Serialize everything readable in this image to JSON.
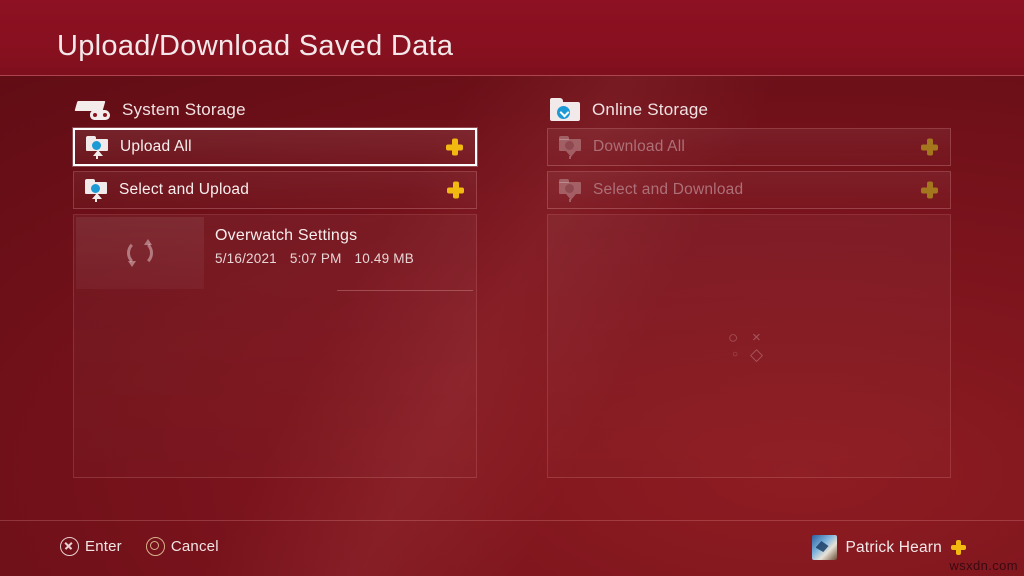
{
  "header": {
    "title": "Upload/Download Saved Data"
  },
  "panels": {
    "left": {
      "heading": "System Storage",
      "heading_icon": "console-icon",
      "actions": [
        {
          "label": "Upload All",
          "icon": "upload-folder-icon",
          "badge": "ps-plus-icon",
          "selected": true,
          "disabled": false
        },
        {
          "label": "Select and Upload",
          "icon": "upload-folder-icon",
          "badge": "ps-plus-icon",
          "selected": false,
          "disabled": false
        }
      ],
      "items": [
        {
          "title": "Overwatch Settings",
          "date": "5/16/2021",
          "time": "5:07 PM",
          "size": "10.49 MB",
          "thumb_icon": "sync-icon"
        }
      ]
    },
    "right": {
      "heading": "Online Storage",
      "heading_icon": "folder-download-icon",
      "actions": [
        {
          "label": "Download All",
          "icon": "download-folder-icon",
          "badge": "ps-plus-icon",
          "selected": false,
          "disabled": true
        },
        {
          "label": "Select and Download",
          "icon": "download-folder-icon",
          "badge": "ps-plus-icon",
          "selected": false,
          "disabled": true
        }
      ],
      "empty_watermark": {
        "circle": "○",
        "cross": "×",
        "dot": "○",
        "diamond": "◇"
      }
    }
  },
  "footer": {
    "hints": [
      {
        "glyph": "cross-button-icon",
        "label": "Enter"
      },
      {
        "glyph": "circle-button-icon",
        "label": "Cancel"
      }
    ],
    "user": {
      "name": "Patrick Hearn",
      "badge": "ps-plus-icon"
    }
  },
  "watermark": "wsxdn.com",
  "colors": {
    "accent_gold": "#f2b911",
    "accent_blue": "#1b9ad6",
    "header_red": "#8d1122",
    "body_red": "#7a131c",
    "disabled_text": "#ad7077"
  }
}
